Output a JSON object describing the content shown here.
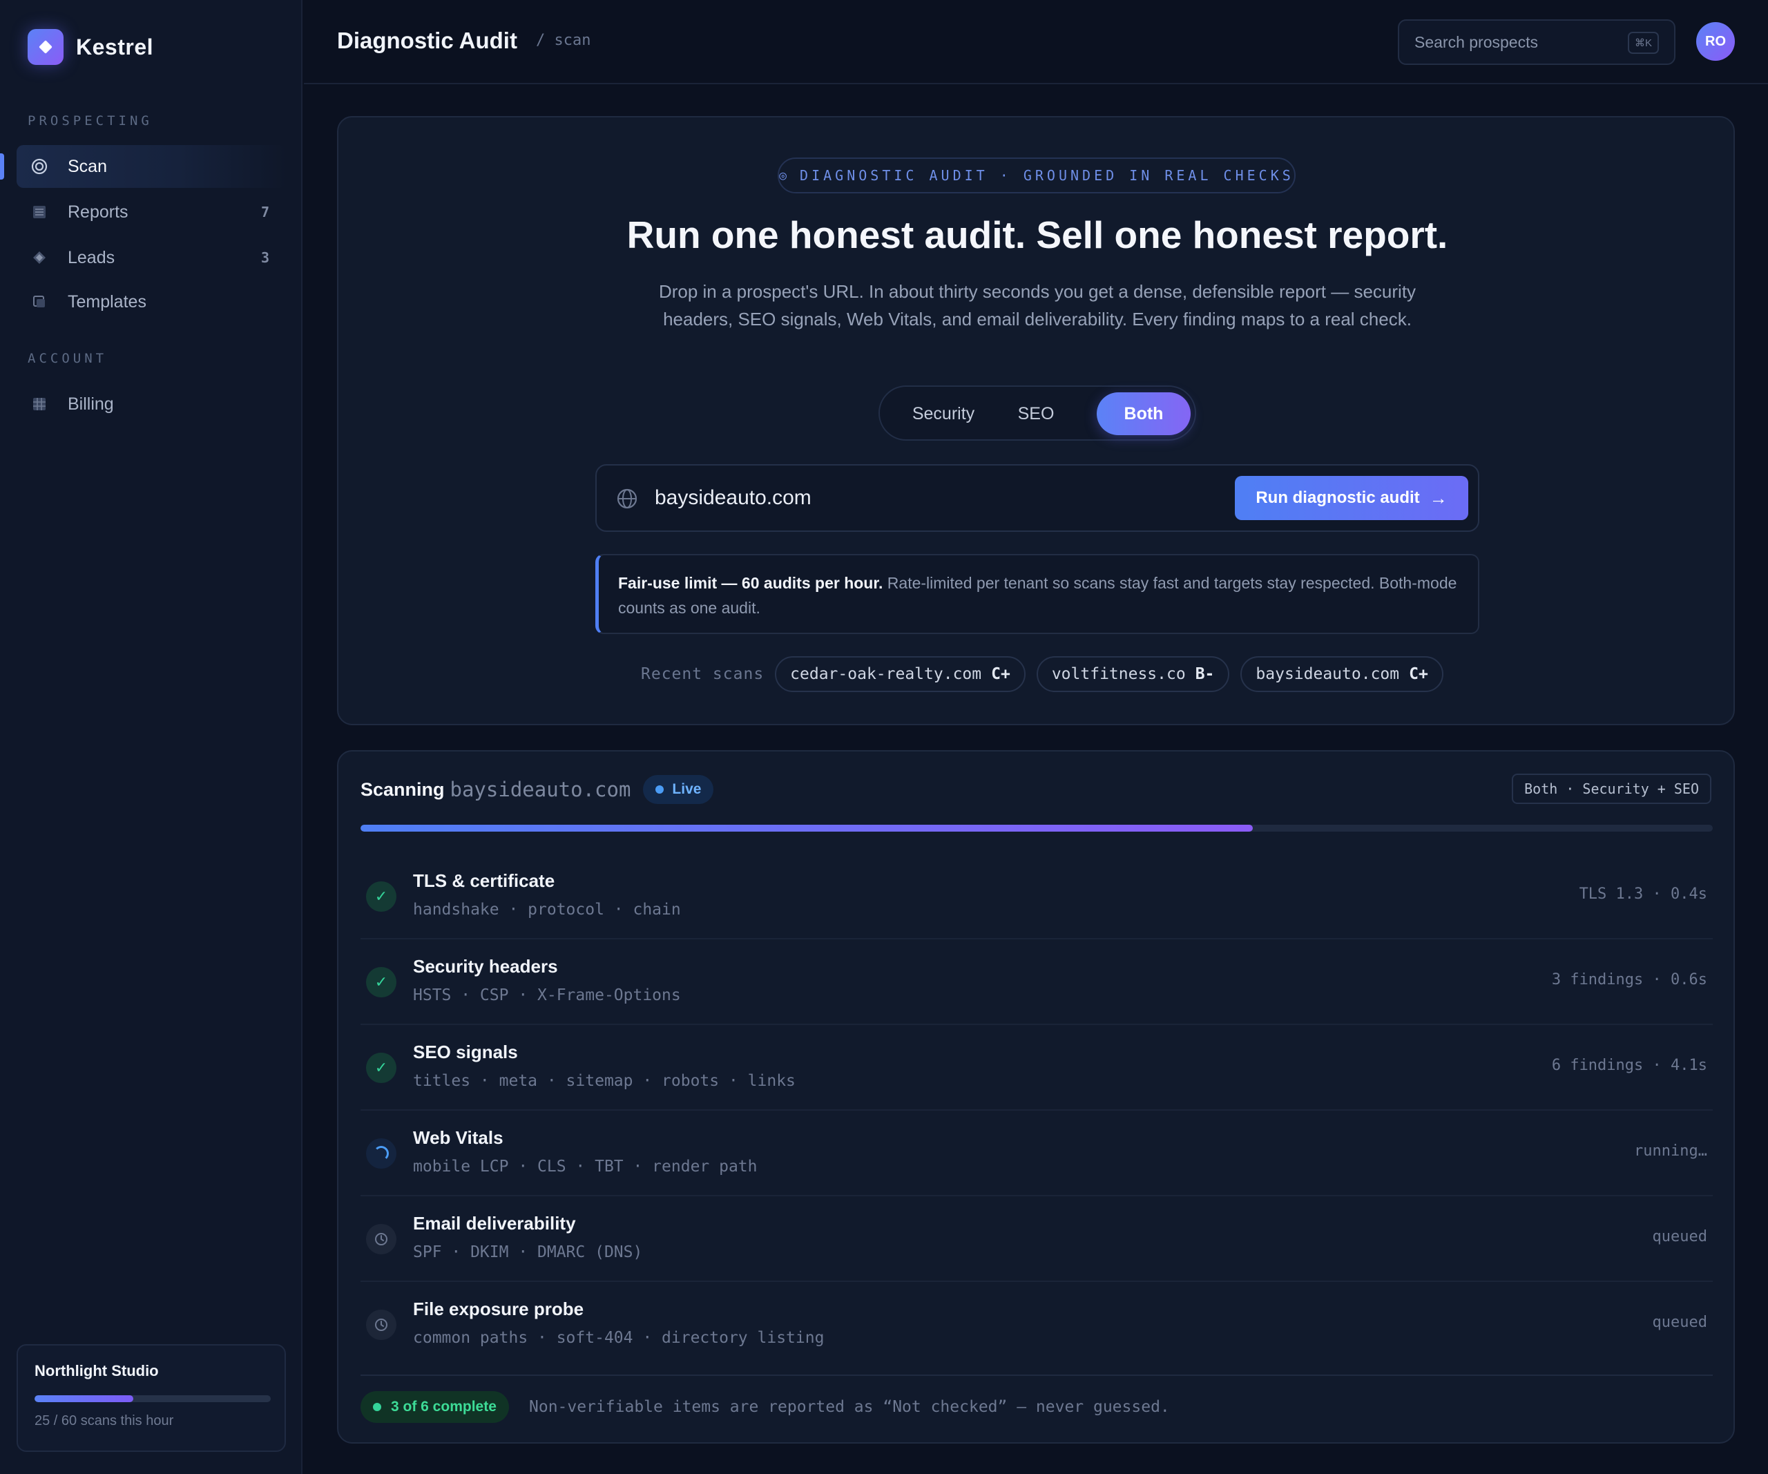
{
  "brand": {
    "name": "Kestrel"
  },
  "sidebar": {
    "sections": [
      {
        "label": "PROSPECTING"
      },
      {
        "label": "ACCOUNT"
      }
    ],
    "items": [
      {
        "label": "Scan",
        "icon": "target-icon",
        "count": ""
      },
      {
        "label": "Reports",
        "icon": "document-icon",
        "count": "7"
      },
      {
        "label": "Leads",
        "icon": "diamond-icon",
        "count": "3"
      },
      {
        "label": "Templates",
        "icon": "template-icon",
        "count": ""
      },
      {
        "label": "Billing",
        "icon": "grid-icon",
        "count": ""
      }
    ],
    "workspace": {
      "name": "Northlight Studio",
      "usage_text": "25 / 60 scans this hour",
      "usage_fraction": 0.4167
    }
  },
  "header": {
    "title": "Diagnostic Audit",
    "breadcrumb": "/  scan",
    "search_placeholder": "Search prospects",
    "search_shortcut": "⌘K",
    "avatar_initials": "RO"
  },
  "hero": {
    "eyebrow": "DIAGNOSTIC AUDIT · GROUNDED IN REAL CHECKS",
    "eyebrow_icon": "◎",
    "headline": "Run one honest audit. Sell one honest report.",
    "subtext": "Drop in a prospect's URL. In about thirty seconds you get a dense, defensible report — security headers, SEO signals, Web Vitals, and email deliverability. Every finding maps to a real check.",
    "modes": [
      "Security",
      "SEO",
      "Both"
    ],
    "selected_mode": "Both",
    "url_value": "baysideauto.com",
    "run_label": "Run diagnostic audit",
    "run_icon": "→",
    "notice_strong": "Fair-use limit — 60 audits per hour.",
    "notice_rest": " Rate-limited per tenant so scans stay fast and targets stay respected. Both-mode counts as one audit.",
    "recent_label": "Recent scans",
    "recent": [
      {
        "domain": "cedar-oak-realty.com",
        "grade": "C+"
      },
      {
        "domain": "voltfitness.co",
        "grade": "B-"
      },
      {
        "domain": "baysideauto.com",
        "grade": "C+"
      }
    ]
  },
  "scan": {
    "label": "Scanning",
    "domain": "baysideauto.com",
    "status": "Live",
    "mode_tag": "Both · Security + SEO",
    "progress_fraction": 0.66,
    "checks": [
      {
        "title": "TLS & certificate",
        "sub": "handshake · protocol · chain",
        "meta": "TLS 1.3 · 0.4s",
        "state": "done"
      },
      {
        "title": "Security headers",
        "sub": "HSTS · CSP · X-Frame-Options",
        "meta": "3 findings · 0.6s",
        "state": "done"
      },
      {
        "title": "SEO signals",
        "sub": "titles · meta · sitemap · robots · links",
        "meta": "6 findings · 4.1s",
        "state": "done"
      },
      {
        "title": "Web Vitals",
        "sub": "mobile LCP · CLS · TBT · render path",
        "meta": "running…",
        "state": "running"
      },
      {
        "title": "Email deliverability",
        "sub": "SPF · DKIM · DMARC (DNS)",
        "meta": "queued",
        "state": "queued"
      },
      {
        "title": "File exposure probe",
        "sub": "common paths · soft-404 · directory listing",
        "meta": "queued",
        "state": "queued"
      }
    ],
    "complete_label": "3 of 6 complete",
    "footnote": "Non-verifiable items are reported as “Not checked” — never guessed."
  },
  "colors": {
    "accent": "#5b82f6",
    "accent_violet": "#8b5cf6",
    "success": "#34d399",
    "live": "#4b9cf5",
    "background": "#0b1120"
  }
}
